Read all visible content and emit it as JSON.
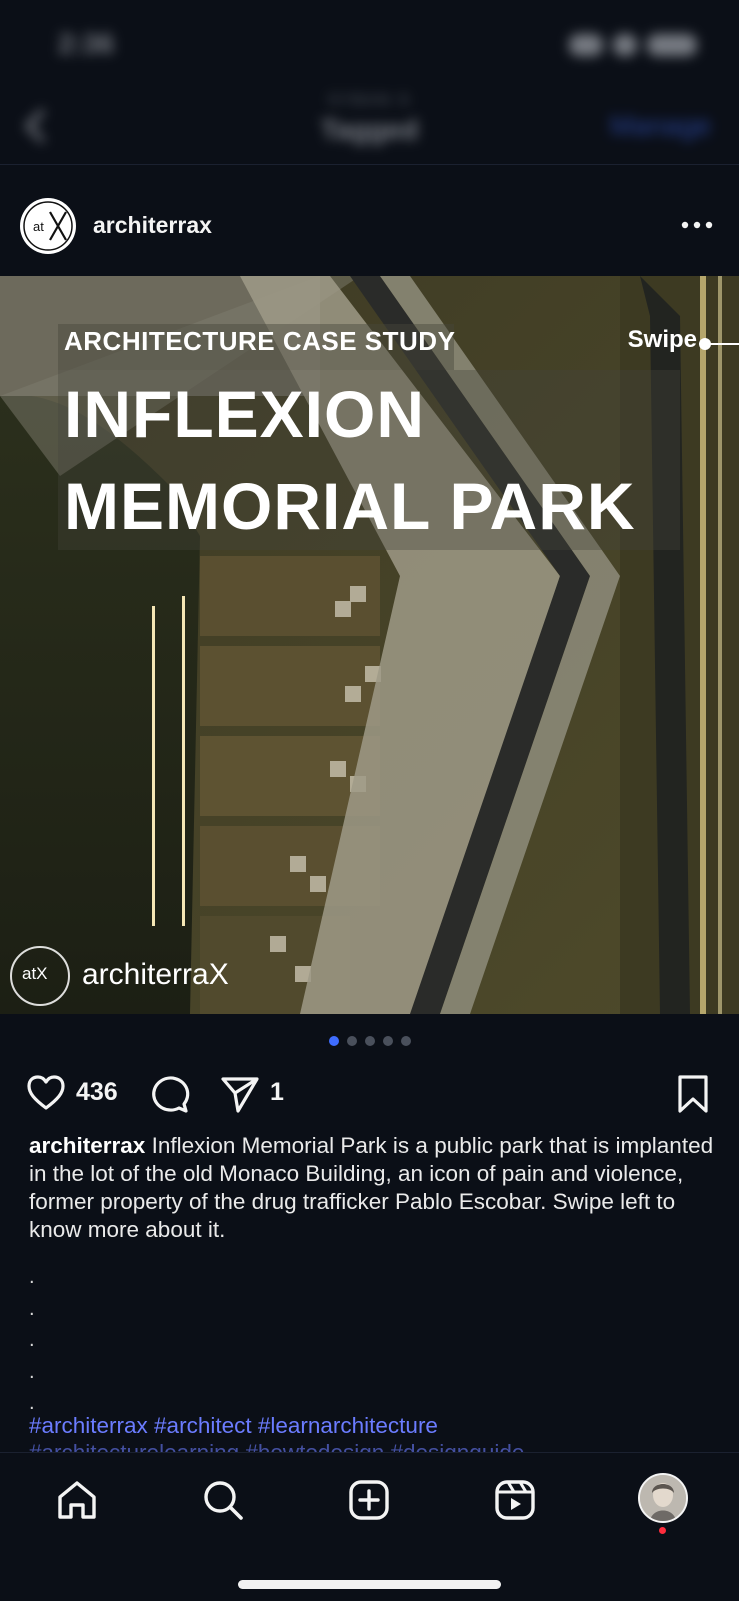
{
  "status_bar": {
    "time": "2:36"
  },
  "top_nav": {
    "subtitle": "SYBAN S",
    "title": "Tagged",
    "manage_label": "Manage"
  },
  "post": {
    "username": "architerrax",
    "image": {
      "kicker": "ARCHITECTURE CASE STUDY",
      "swipe": "Swipe",
      "headline_line1": "INFLEXION",
      "headline_line2": "MEMORIAL PARK",
      "watermark_logo": "atX",
      "watermark_text": "architerraX"
    },
    "carousel": {
      "count": 5,
      "active": 1
    },
    "likes": "436",
    "shares": "1",
    "caption_user": "architerrax",
    "caption_text": "Inflexion Memorial Park is a public park that is implanted in the lot of the old Monaco Building, an icon of pain and violence, former property of the drug trafficker Pablo Escobar.  Swipe left to know more about it.",
    "dot_lines": [
      ".",
      ".",
      ".",
      ".",
      "."
    ],
    "hashtags": "#architerrax #architect #learnarchitecture",
    "hashtags_cut": "#architecturelearning #howtodesign #designguide"
  },
  "icons": {
    "back": "chevron-left-icon",
    "more": "more-horizontal-icon",
    "like": "heart-icon",
    "comment": "comment-icon",
    "share": "send-icon",
    "save": "bookmark-icon",
    "home": "home-icon",
    "search": "search-icon",
    "create": "plus-square-icon",
    "reels": "reels-icon",
    "profile": "profile-avatar"
  },
  "colors": {
    "background": "#0b0f17",
    "accent": "#3f6dff",
    "hashtag": "#6b7cff",
    "notification": "#ff2d3d"
  }
}
